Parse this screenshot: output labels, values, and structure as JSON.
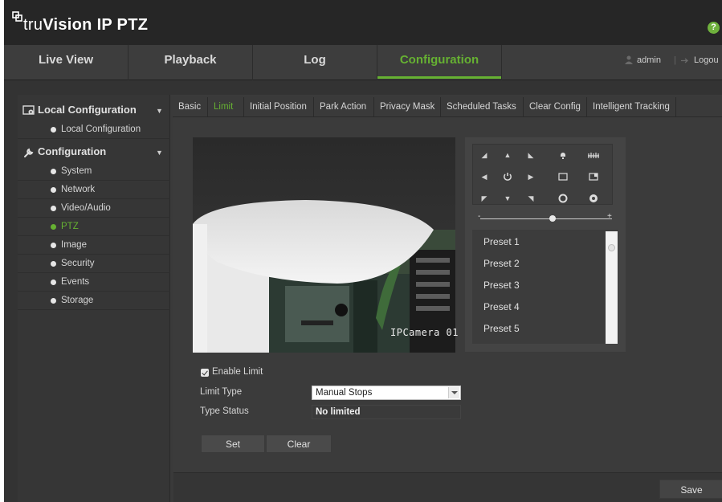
{
  "app": {
    "brand_prefix": "tru",
    "brand_name": "Vision",
    "brand_suffix": "IP PTZ",
    "help_label": "?"
  },
  "nav": {
    "tabs": [
      {
        "label": "Live View"
      },
      {
        "label": "Playback"
      },
      {
        "label": "Log"
      },
      {
        "label": "Configuration",
        "active": true
      }
    ],
    "user": "admin",
    "logout": "Logou",
    "accent_color": "#66b132"
  },
  "sidebar": {
    "sections": [
      {
        "label": "Local Configuration",
        "icon": "local-config-icon",
        "items": [
          "Local Configuration"
        ]
      },
      {
        "label": "Configuration",
        "icon": "wrench-icon",
        "items": [
          "System",
          "Network",
          "Video/Audio",
          "PTZ",
          "Image",
          "Security",
          "Events",
          "Storage"
        ],
        "active_item": "PTZ"
      }
    ]
  },
  "subtabs": [
    {
      "label": "Basic"
    },
    {
      "label": "Limit",
      "active": true
    },
    {
      "label": "Initial Position"
    },
    {
      "label": "Park Action"
    },
    {
      "label": "Privacy Mask"
    },
    {
      "label": "Scheduled Tasks"
    },
    {
      "label": "Clear Config"
    },
    {
      "label": "Intelligent Tracking"
    }
  ],
  "video": {
    "osd_text": "IPCamera 01"
  },
  "ptz": {
    "slider_minus": "-",
    "slider_plus": "+",
    "zoom_level_fraction": 0.55,
    "presets": [
      "Preset 1",
      "Preset 2",
      "Preset 3",
      "Preset 4",
      "Preset 5"
    ]
  },
  "limit": {
    "enable_label": "Enable Limit",
    "enable_checked": true,
    "type_label": "Limit Type",
    "type_value": "Manual Stops",
    "status_label": "Type Status",
    "status_value": "No limited",
    "set_label": "Set",
    "clear_label": "Clear"
  },
  "footer": {
    "save_label": "Save"
  }
}
